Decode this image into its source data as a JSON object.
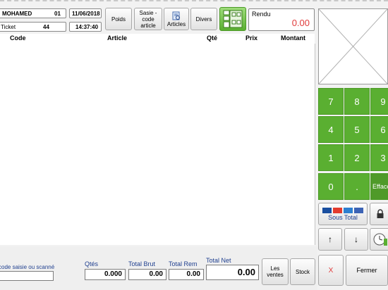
{
  "header": {
    "user": "MOHAMED",
    "user_no": "01",
    "date": "11/06/2018",
    "ticket_label": "Ticket",
    "ticket_no": "44",
    "time": "14:37:40"
  },
  "toolbar": {
    "poids": "Poids",
    "saisie": "Sasie -\ncode article",
    "articles": "Articles",
    "divers": "Divers"
  },
  "rendu": {
    "label": "Rendu",
    "value": "0.00"
  },
  "columns": {
    "code": "Code",
    "article": "Article",
    "qte": "Qté",
    "prix": "Prix",
    "montant": "Montant"
  },
  "rows": [],
  "keypad": {
    "keys": [
      "7",
      "8",
      "9",
      "4",
      "5",
      "6",
      "1",
      "2",
      "3",
      "0",
      ".",
      "Efface"
    ]
  },
  "payment": {
    "sous_total": "Sous Total"
  },
  "arrows": {
    "up": "↑",
    "down": "↓"
  },
  "footer": {
    "code_label": "code saisie ou scanné",
    "code_value": "",
    "qtes_label": "Qtés",
    "qtes_value": "0.000",
    "total_brut_label": "Total Brut",
    "total_brut_value": "0.00",
    "total_rem_label": "Total Rem",
    "total_rem_value": "0.00",
    "total_net_label": "Total Net",
    "total_net_value": "0.00",
    "les_ventes": "Les\nventes",
    "stock": "Stock",
    "x": "X",
    "fermer": "Fermer"
  },
  "colors": {
    "keypad_green": "#5aaf31",
    "total_red": "#e03a3a",
    "label_blue": "#1f3f8f"
  }
}
